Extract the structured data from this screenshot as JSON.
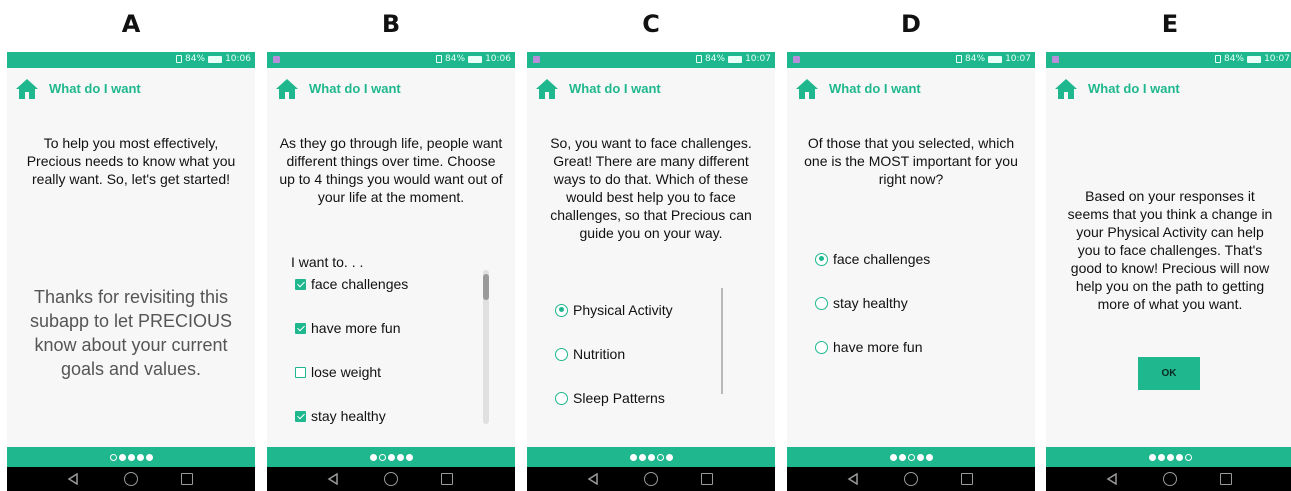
{
  "common": {
    "app_title": "What do I want",
    "home_icon": "home-icon",
    "accent_color": "#1fb88e"
  },
  "panels": [
    {
      "letter": "A",
      "status": {
        "battery": "84%",
        "time": "10:06",
        "notification": false
      },
      "question": "To help you most effectively, Precious needs to know what you really want. So, let's get started!",
      "note": "Thanks for revisiting this subapp to let PRECIOUS know about your current goals and values.",
      "page_current": 1,
      "page_total": 5
    },
    {
      "letter": "B",
      "status": {
        "battery": "84%",
        "time": "10:06",
        "notification": true
      },
      "question": "As they go through life, people want different things over time. Choose up to 4 things you would want out of your life at the moment.",
      "prompt": "I want to. . .",
      "options": [
        {
          "label": "face challenges",
          "checked": true
        },
        {
          "label": "have more fun",
          "checked": true
        },
        {
          "label": "lose weight",
          "checked": false
        },
        {
          "label": "stay healthy",
          "checked": true
        }
      ],
      "page_current": 2,
      "page_total": 5
    },
    {
      "letter": "C",
      "status": {
        "battery": "84%",
        "time": "10:07",
        "notification": true
      },
      "question": "So, you want to face challenges. Great! There are many different ways to do that. Which of these would best help you to face challenges, so that Precious can guide you on your way.",
      "options": [
        {
          "label": "Physical Activity",
          "selected": true
        },
        {
          "label": "Nutrition",
          "selected": false
        },
        {
          "label": "Sleep Patterns",
          "selected": false
        }
      ],
      "page_current": 4,
      "page_total": 5
    },
    {
      "letter": "D",
      "status": {
        "battery": "84%",
        "time": "10:07",
        "notification": true
      },
      "question": "Of those that you selected, which one is the MOST important for you right now?",
      "options": [
        {
          "label": "face challenges",
          "selected": true
        },
        {
          "label": "stay healthy",
          "selected": false
        },
        {
          "label": "have more fun",
          "selected": false
        }
      ],
      "page_current": 3,
      "page_total": 5
    },
    {
      "letter": "E",
      "status": {
        "battery": "84%",
        "time": "10:07",
        "notification": true
      },
      "question": "Based on your responses it seems that you think a change in your Physical Activity can help you to face challenges. That's good to know! Precious will now help you on the path to getting more of what you want.",
      "ok_label": "OK",
      "page_current": 5,
      "page_total": 5
    }
  ]
}
